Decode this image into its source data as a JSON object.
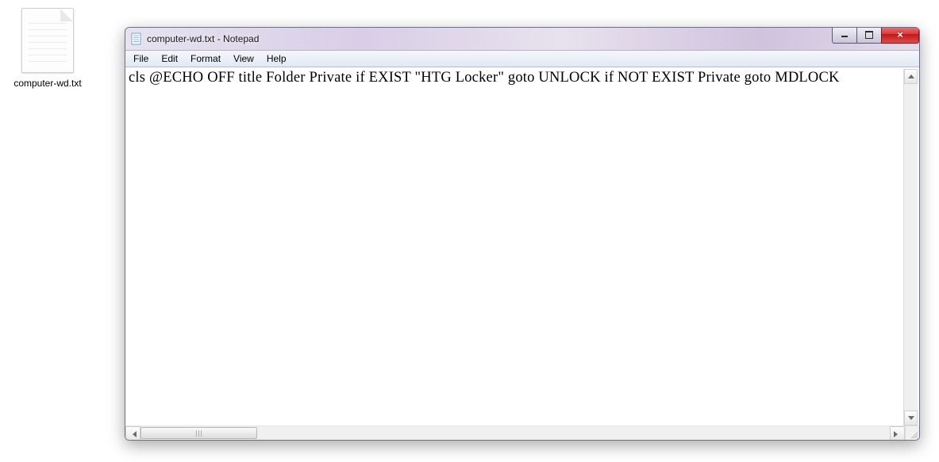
{
  "desktop": {
    "file_label": "computer-wd.txt"
  },
  "window": {
    "title": "computer-wd.txt - Notepad",
    "menu": {
      "file": "File",
      "edit": "Edit",
      "format": "Format",
      "view": "View",
      "help": "Help"
    },
    "content": "cls @ECHO OFF title Folder Private if EXIST \"HTG Locker\" goto UNLOCK if NOT EXIST Private goto MDLOCK"
  }
}
